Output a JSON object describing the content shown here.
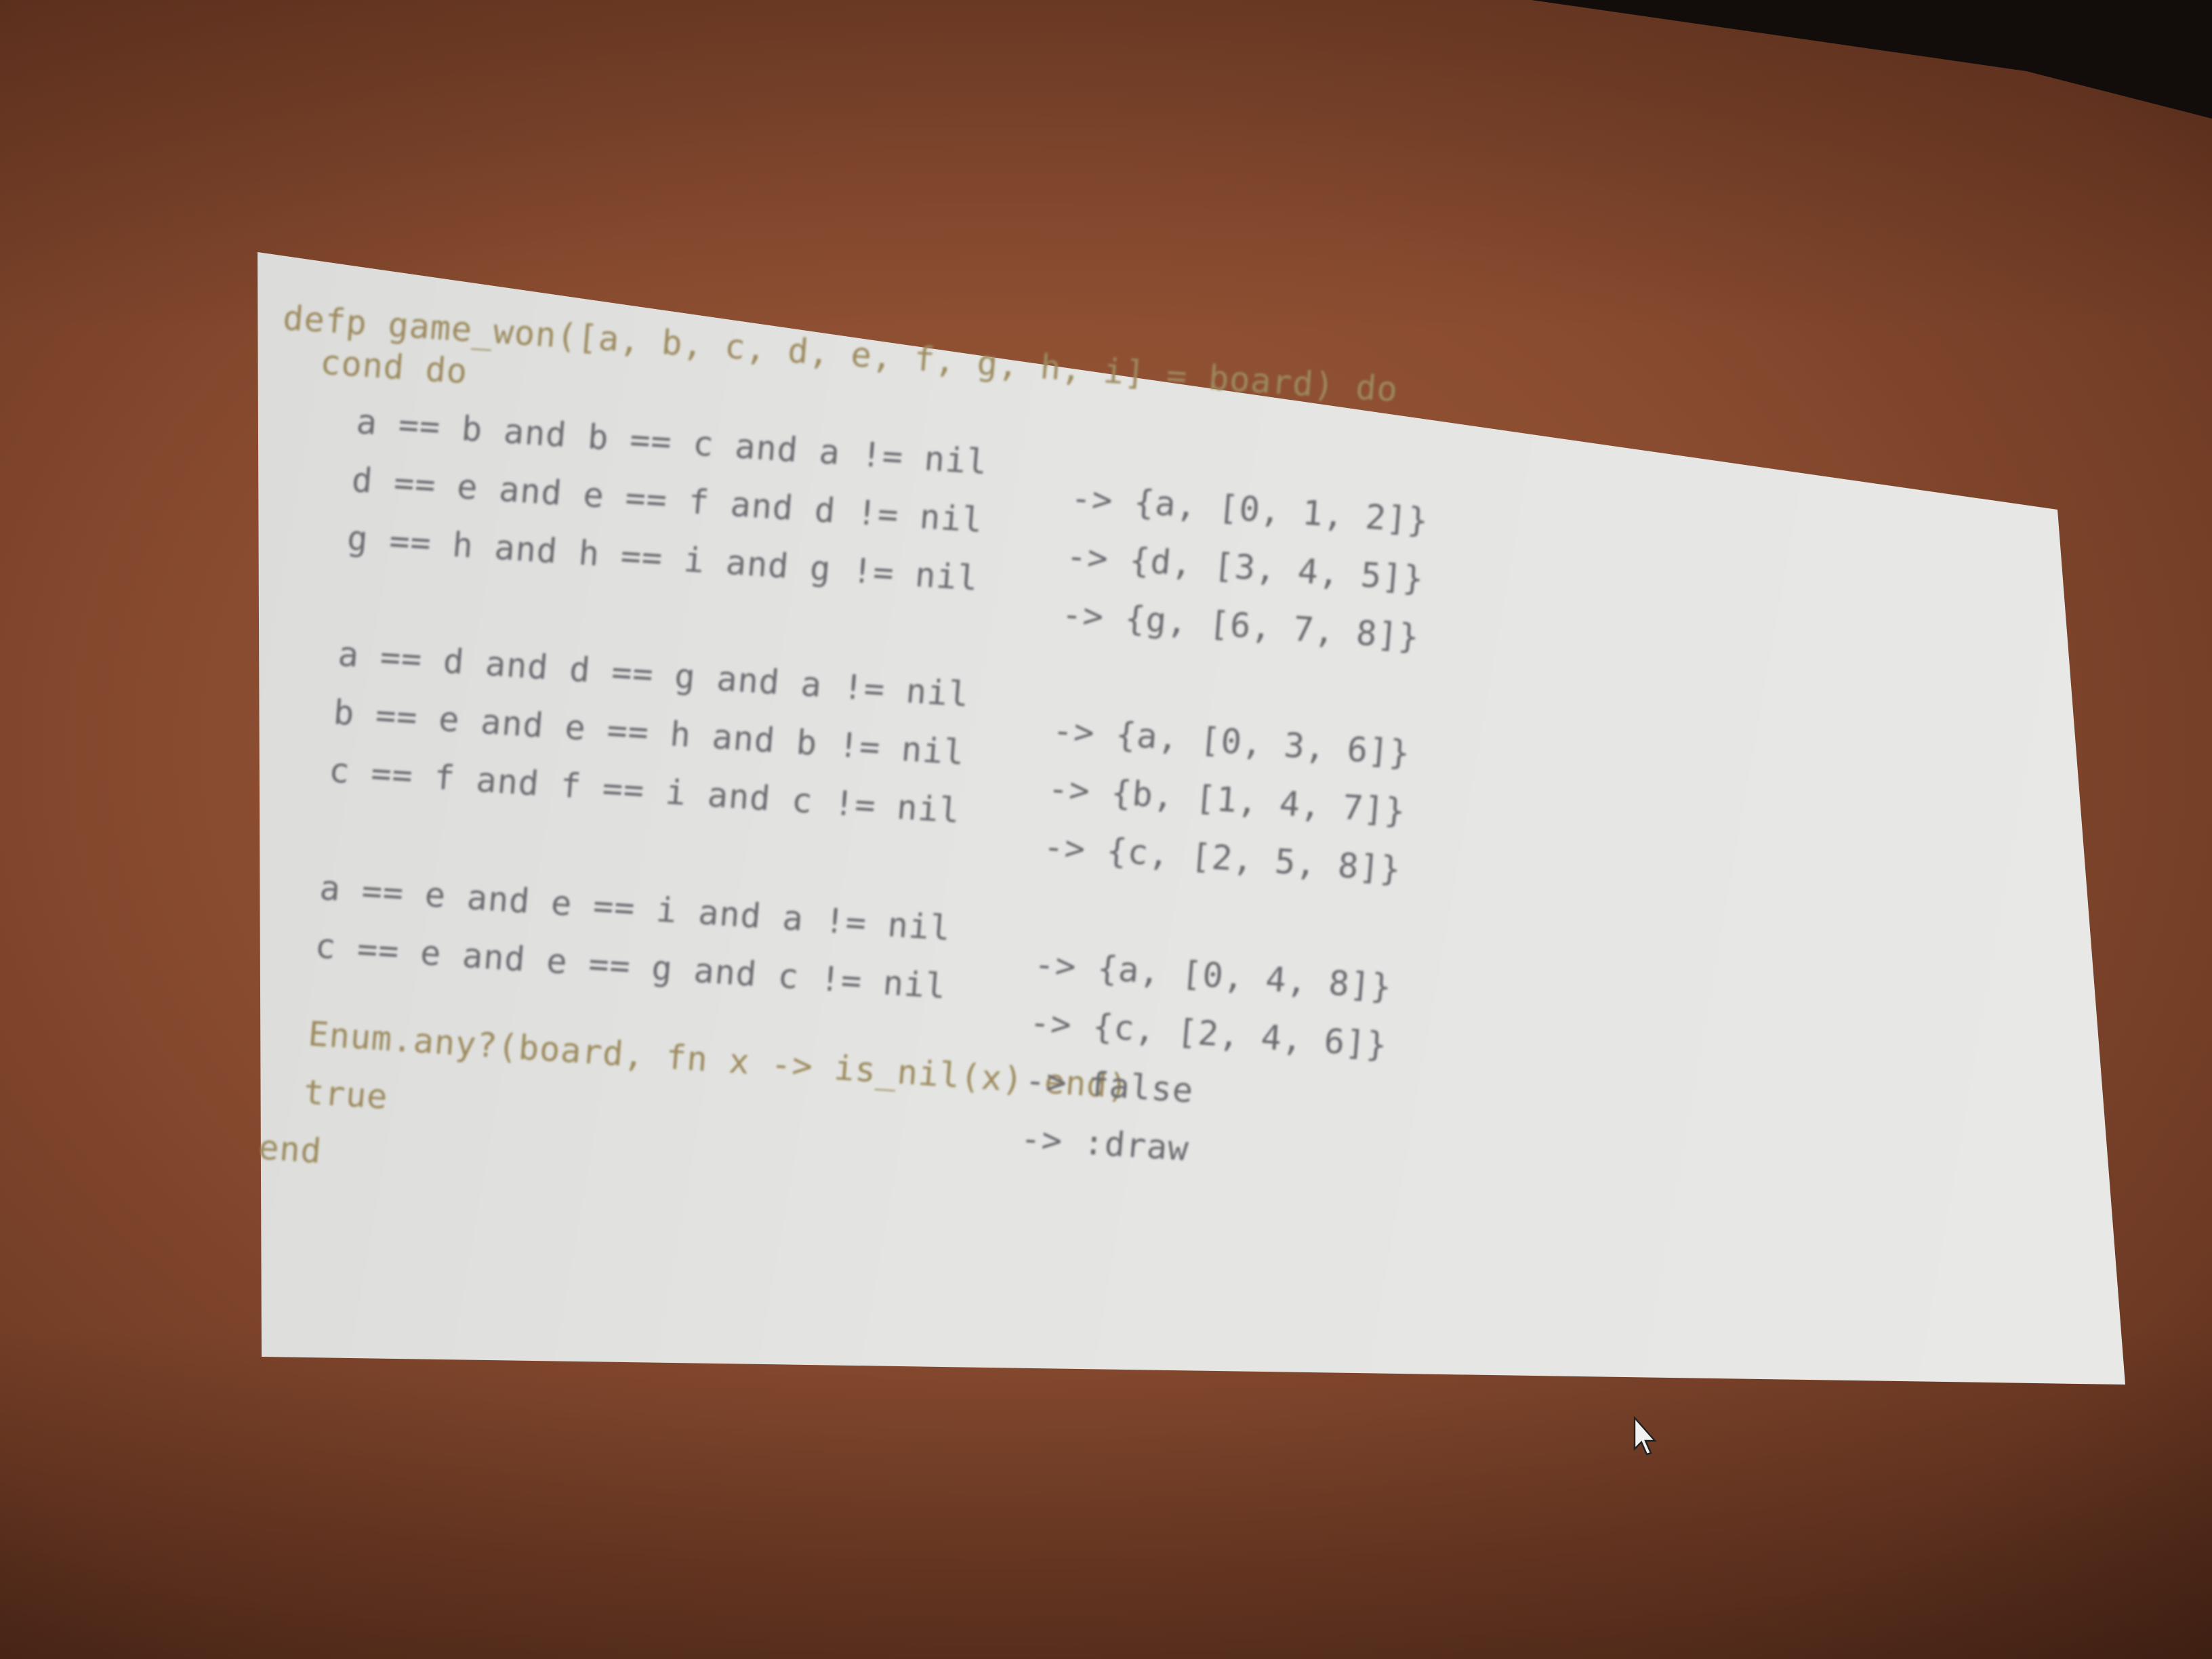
{
  "slide": {
    "code_lines": [
      "defp game_won([a, b, c, d, e, f, g, h, i] = board) do",
      "cond do",
      "a == b and b == c and a != nil",
      "d == e and e == f and d != nil",
      "g == h and h == i and g != nil",
      "a == d and d == g and a != nil",
      "b == e and e == h and b != nil",
      "c == f and f == i and c != nil",
      "a == e and e == i and a != nil",
      "c == e and e == g and c != nil",
      "Enum.any?(board, fn x -> is_nil(x) end)",
      "true",
      "end"
    ],
    "results": [
      "-> {a, [0, 1, 2]}",
      "-> {d, [3, 4, 5]}",
      "-> {g, [6, 7, 8]}",
      "-> {a, [0, 3, 6]}",
      "-> {b, [1, 4, 7]}",
      "-> {c, [2, 5, 8]}",
      "-> {a, [0, 4, 8]}",
      "-> {c, [2, 4, 6]}",
      "-> false",
      "-> :draw"
    ]
  },
  "colors": {
    "wall": "#8a4c30",
    "slide_background": "#e6e7e4",
    "code_text": "#6a6a70",
    "keyword_text": "#9c8a5e"
  },
  "icons": {
    "cursor": "mouse-pointer-icon"
  }
}
